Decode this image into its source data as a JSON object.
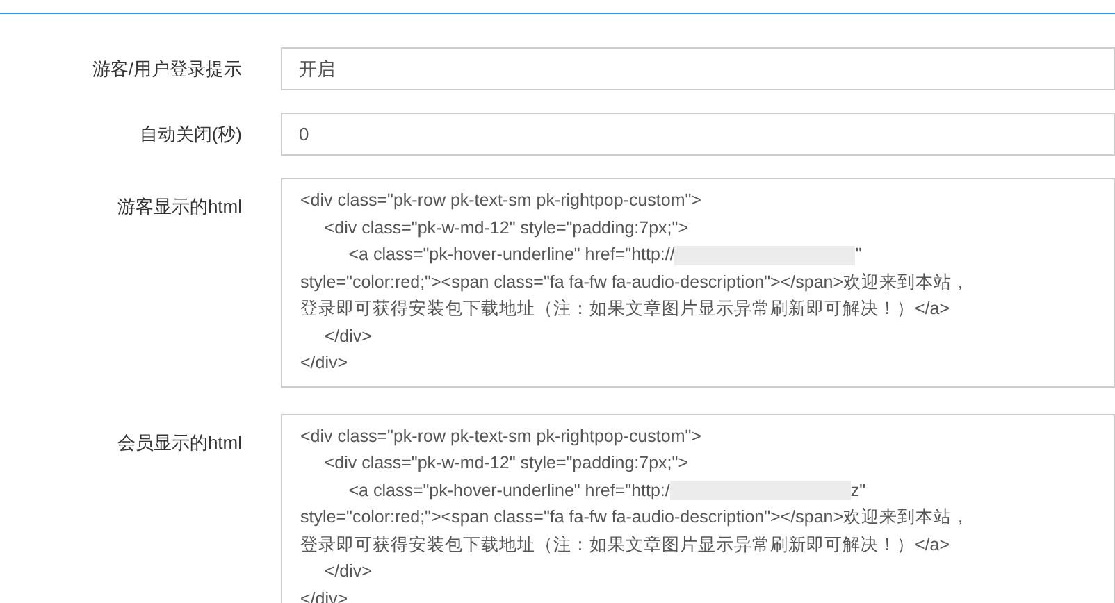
{
  "fields": [
    {
      "kind": "input",
      "label": "游客/用户登录提示",
      "value": "开启"
    },
    {
      "kind": "input",
      "label": "自动关闭(秒)",
      "value": "0"
    },
    {
      "kind": "textarea",
      "label": "游客显示的html",
      "lines": [
        {
          "text": "<div class=\"pk-row pk-text-sm pk-rightpop-custom\">"
        },
        {
          "text": "\t<div class=\"pk-w-md-12\" style=\"padding:7px;\">"
        },
        {
          "text": "\t\t<a class=\"pk-hover-underline\" href=\"http://",
          "redacted": true,
          "after": "\""
        },
        {
          "text": "style=\"color:red;\"><span class=\"fa fa-fw fa-audio-description\"></span>欢迎来到本站，"
        },
        {
          "text": "登录即可获得安装包下载地址（注：如果文章图片显示异常刷新即可解决！）</a>"
        },
        {
          "text": "\t</div>"
        },
        {
          "text": "</div>"
        }
      ]
    },
    {
      "kind": "textarea",
      "label": "会员显示的html",
      "lines": [
        {
          "text": "<div class=\"pk-row pk-text-sm pk-rightpop-custom\">"
        },
        {
          "text": "\t<div class=\"pk-w-md-12\" style=\"padding:7px;\">"
        },
        {
          "text": "\t\t<a class=\"pk-hover-underline\" href=\"http:/",
          "redacted": true,
          "after": "z\""
        },
        {
          "text": "style=\"color:red;\"><span class=\"fa fa-fw fa-audio-description\"></span>欢迎来到本站，"
        },
        {
          "text": "登录即可获得安装包下载地址（注：如果文章图片显示异常刷新即可解决！）</a>"
        },
        {
          "text": "\t</div>"
        },
        {
          "text": "</div>"
        }
      ]
    }
  ]
}
